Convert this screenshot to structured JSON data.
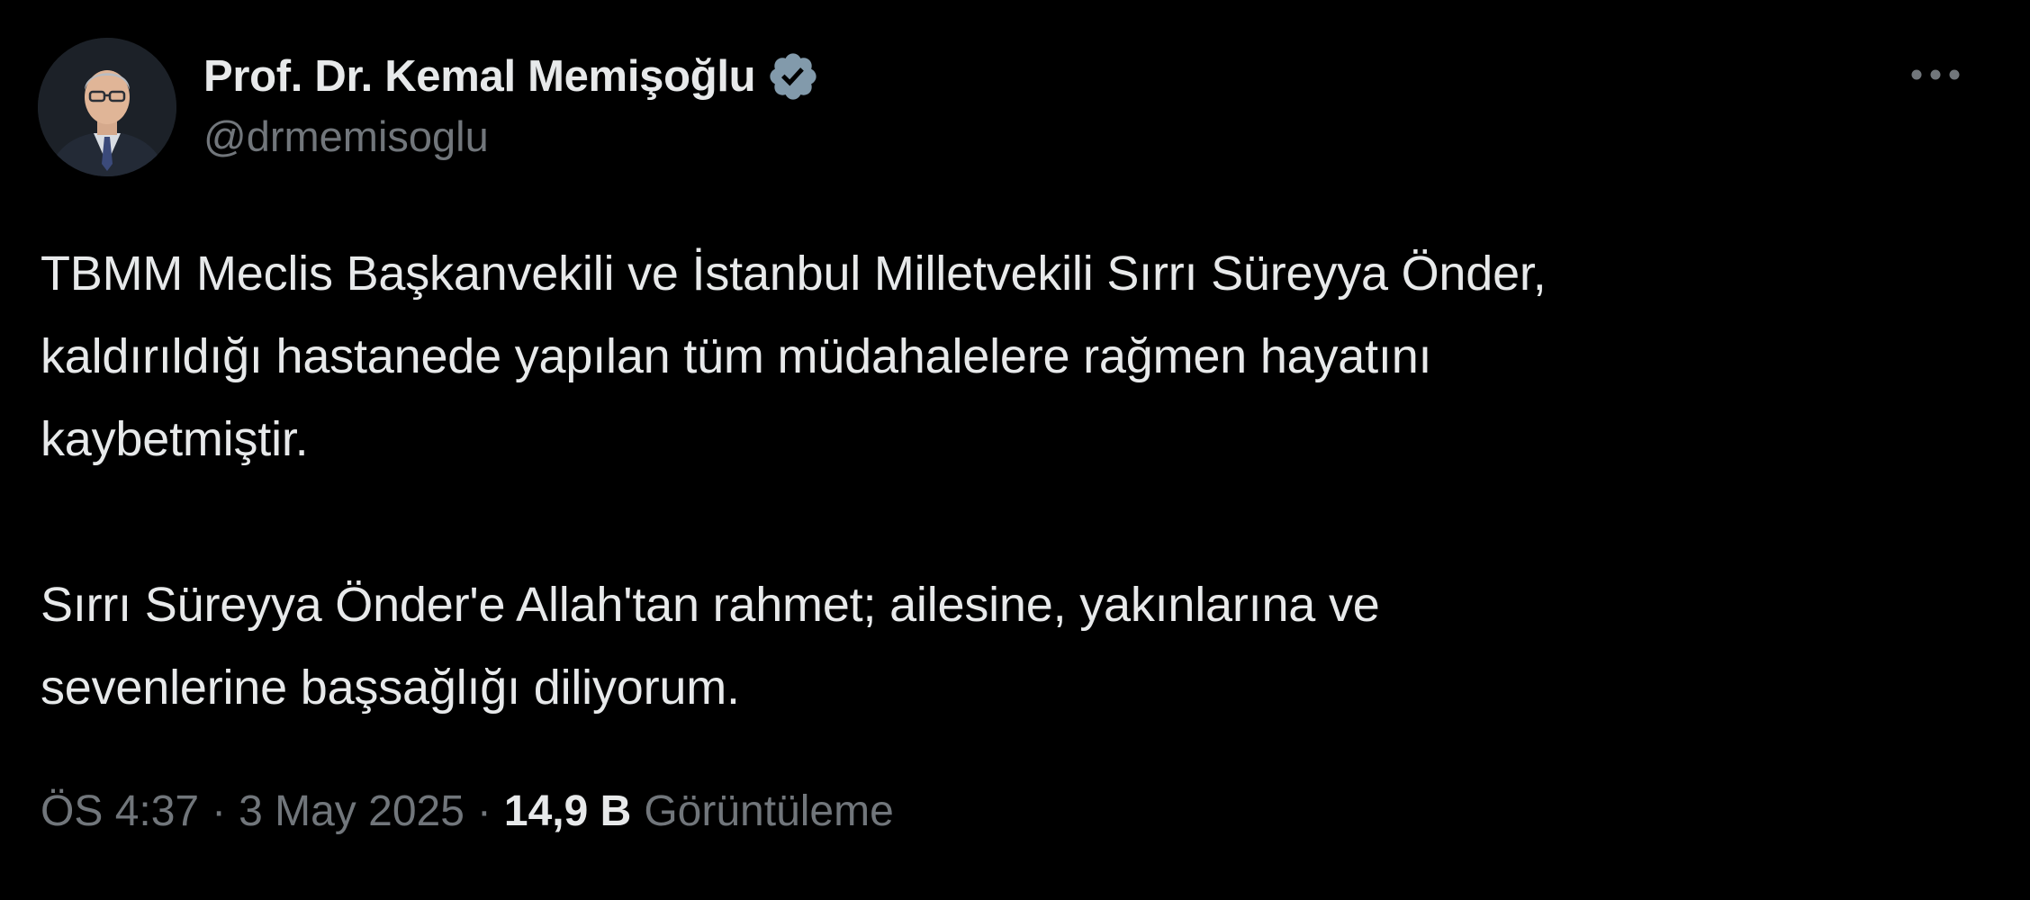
{
  "author": {
    "display_name": "Prof. Dr. Kemal Memişoğlu",
    "handle": "@drmemisoglu",
    "verified_icon": "verified-badge-icon",
    "avatar_icon": "profile-photo"
  },
  "menu": {
    "more_icon": "more-horizontal-icon",
    "more_glyph": "•••"
  },
  "tweet": {
    "text": "TBMM Meclis Başkanvekili ve İstanbul Milletvekili Sırrı Süreyya Önder,\nkaldırıldığı hastanede yapılan tüm müdahalelere rağmen hayatını\nkaybetmiştir.\n\nSırrı Süreyya Önder'e Allah'tan rahmet; ailesine, yakınlarına ve\nsevenlerine başsağlığı diliyorum."
  },
  "meta": {
    "time": "ÖS 4:37",
    "separator": "·",
    "date": "3 May 2025",
    "views_count": "14,9 B",
    "views_label": "Görüntüleme"
  },
  "colors": {
    "background": "#000000",
    "primary_text": "#e7e9ea",
    "secondary_text": "#71767b",
    "verified_badge": "#829aab"
  }
}
